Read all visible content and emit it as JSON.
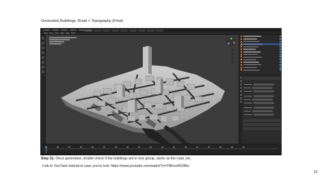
{
  "page": {
    "title": "Generated Buildings, Road + Topography (Final)",
    "caption_step": "Step 11:",
    "caption_text": " Once generated, double check if the buildings are in one group, same as the road, etc.",
    "link_prefix": "Link to YouTube tutorial in case you’re lost: ",
    "link_url": "https://www.youtube.com/watch?v=YNKcmROtf6o",
    "page_number": "21"
  },
  "screenshot": {
    "app": "Blender",
    "viewport_background": "#3c3c3c",
    "building_color": "#a9a9a9",
    "road_color": "#1c1c1c",
    "selection_color": "#334d80",
    "accent_orange": "#e08a3c"
  }
}
